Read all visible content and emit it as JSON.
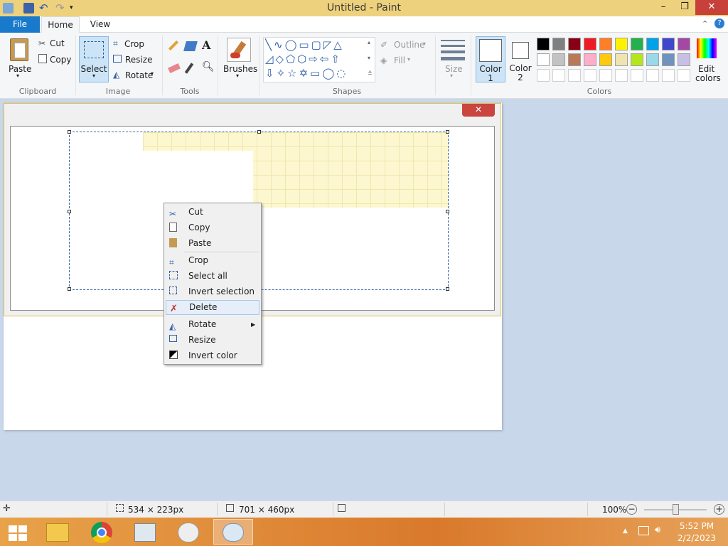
{
  "window": {
    "title": "Untitled - Paint"
  },
  "tabs": {
    "file": "File",
    "home": "Home",
    "view": "View"
  },
  "ribbon": {
    "clipboard": {
      "paste": "Paste",
      "cut": "Cut",
      "copy": "Copy",
      "label": "Clipboard"
    },
    "image": {
      "select": "Select",
      "crop": "Crop",
      "resize": "Resize",
      "rotate": "Rotate",
      "label": "Image"
    },
    "tools": {
      "label": "Tools"
    },
    "brushes": {
      "label": "Brushes"
    },
    "shapes": {
      "outline": "Outline",
      "fill": "Fill",
      "label": "Shapes"
    },
    "size": {
      "label": "Size"
    },
    "color1": {
      "line1": "Color",
      "line2": "1"
    },
    "color2": {
      "line1": "Color",
      "line2": "2"
    },
    "colors": {
      "label": "Colors",
      "edit_line1": "Edit",
      "edit_line2": "colors",
      "row1": [
        "#000000",
        "#7f7f7f",
        "#880015",
        "#ed1c24",
        "#ff7f27",
        "#fff200",
        "#22b14c",
        "#00a2e8",
        "#3f48cc",
        "#a349a4"
      ],
      "row2": [
        "#ffffff",
        "#c3c3c3",
        "#b97a57",
        "#ffaec9",
        "#ffc90e",
        "#efe4b0",
        "#b5e61d",
        "#99d9ea",
        "#7092be",
        "#c8bfe7"
      ]
    }
  },
  "context_menu": {
    "items": [
      {
        "label": "Cut",
        "icon": "scissors-icon"
      },
      {
        "label": "Copy",
        "icon": "copy-icon"
      },
      {
        "label": "Paste",
        "icon": "paste-icon"
      },
      {
        "label": "Crop",
        "icon": "crop-icon"
      },
      {
        "label": "Select all",
        "icon": "select-all-icon"
      },
      {
        "label": "Invert selection",
        "icon": "invert-selection-icon"
      },
      {
        "label": "Delete",
        "icon": "delete-icon"
      },
      {
        "label": "Rotate",
        "icon": "rotate-icon"
      },
      {
        "label": "Resize",
        "icon": "resize-icon"
      },
      {
        "label": "Invert color",
        "icon": "invert-color-icon"
      }
    ]
  },
  "status": {
    "selection_size": "534 × 223px",
    "canvas_size": "701 × 460px",
    "zoom": "100%",
    "zoom_out": "−",
    "zoom_in": "+"
  },
  "taskbar": {
    "time": "5:52 PM",
    "date": "2/2/2023"
  },
  "accent": "#1979ca"
}
